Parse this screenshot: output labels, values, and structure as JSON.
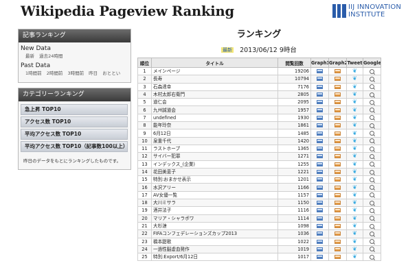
{
  "header": {
    "title": "Wikipedia Pageview Ranking",
    "logo_line1": "IIJ INNOVATION",
    "logo_line2": "INSTITUTE",
    "brand_color": "#2a5caa"
  },
  "sidebar": {
    "article_ranking": {
      "heading": "記事ランキング",
      "new_data_label": "New Data",
      "new_data_links": [
        "最新",
        "過去24時間"
      ],
      "past_data_label": "Past Data",
      "past_data_links": [
        "1時間前",
        "2時間前",
        "3時間前",
        "昨日",
        "おととい"
      ]
    },
    "category_ranking": {
      "heading": "カテゴリーランキング",
      "items": [
        "急上昇 TOP10",
        "アクセス数 TOP10",
        "平均アクセス数 TOP10",
        "平均アクセス数 TOP10（記事数100以上）"
      ],
      "note": "昨日のデータをもとにランキングしたものです。"
    }
  },
  "main": {
    "title": "ランキング",
    "badge": "最新",
    "datetime": "2013/06/12 9時台",
    "columns": [
      "順位",
      "タイトル",
      "閲覧回数",
      "Graph1",
      "Graph2",
      "Tweet",
      "Google"
    ],
    "rows": [
      {
        "rank": "1",
        "title": "メインページ",
        "count": "19206"
      },
      {
        "rank": "2",
        "title": "長寿",
        "count": "10794"
      },
      {
        "rank": "3",
        "title": "石森達幸",
        "count": "7176"
      },
      {
        "rank": "4",
        "title": "木村太郎右衛門",
        "count": "2805"
      },
      {
        "rank": "5",
        "title": "道仁会",
        "count": "2095"
      },
      {
        "rank": "6",
        "title": "九州誠道会",
        "count": "1957"
      },
      {
        "rank": "7",
        "title": "undefined",
        "count": "1930"
      },
      {
        "rank": "8",
        "title": "能年玲奈",
        "count": "1861"
      },
      {
        "rank": "9",
        "title": "6月12日",
        "count": "1485"
      },
      {
        "rank": "10",
        "title": "泉重千代",
        "count": "1420"
      },
      {
        "rank": "11",
        "title": "ラストホープ",
        "count": "1365"
      },
      {
        "rank": "12",
        "title": "サイバー犯罪",
        "count": "1271"
      },
      {
        "rank": "13",
        "title": "インデックス_(企業)",
        "count": "1255"
      },
      {
        "rank": "14",
        "title": "花田美恵子",
        "count": "1221"
      },
      {
        "rank": "15",
        "title": "特別:おまかせ表示",
        "count": "1201"
      },
      {
        "rank": "16",
        "title": "水沢アリー",
        "count": "1166"
      },
      {
        "rank": "17",
        "title": "AV女優一覧",
        "count": "1157"
      },
      {
        "rank": "18",
        "title": "大川ミサラ",
        "count": "1150"
      },
      {
        "rank": "19",
        "title": "酒井法子",
        "count": "1116"
      },
      {
        "rank": "20",
        "title": "マリア・シャラポワ",
        "count": "1114"
      },
      {
        "rank": "21",
        "title": "大杉漣",
        "count": "1098"
      },
      {
        "rank": "22",
        "title": "FIFAコンフェデレーションズカップ2013",
        "count": "1036"
      },
      {
        "rank": "23",
        "title": "橋本甜歌",
        "count": "1022"
      },
      {
        "rank": "24",
        "title": "一過性脳虚血発作",
        "count": "1019"
      },
      {
        "rank": "25",
        "title": "特別:Export/6月12日",
        "count": "1017"
      }
    ]
  }
}
